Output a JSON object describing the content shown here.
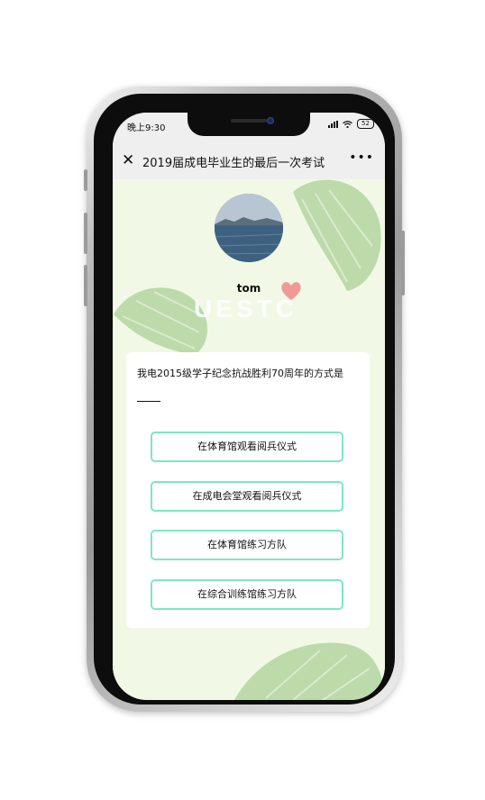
{
  "status_bar": {
    "time": "晚上9:30",
    "battery": "52"
  },
  "nav": {
    "close_icon": "close-icon",
    "title": "2019届成电毕业生的最后一次考试",
    "more_icon": "more-icon"
  },
  "profile": {
    "username": "tom",
    "watermark": "UESTC"
  },
  "quiz": {
    "question": "我电2015级学子纪念抗战胜利70周年的方式是",
    "options": [
      "在体育馆观看阅兵仪式",
      "在成电会堂观看阅兵仪式",
      "在体育馆练习方队",
      "在综合训练馆练习方队"
    ]
  },
  "colors": {
    "background": "#f1f9e6",
    "option_border": "#7de6c6",
    "nav_bg": "#efefef"
  }
}
